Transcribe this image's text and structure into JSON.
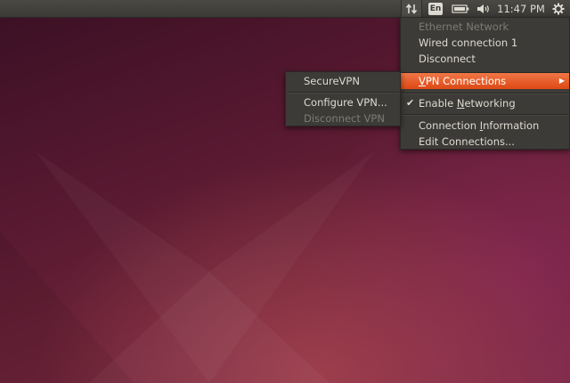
{
  "panel": {
    "keyboard_layout": "En",
    "clock": "11:47 PM",
    "icons": {
      "network": "network-updown-icon",
      "battery": "battery-icon",
      "sound": "speaker-volume-icon",
      "session": "gear-icon"
    }
  },
  "network_menu": {
    "section_header": "Ethernet Network",
    "wired_connection": "Wired connection 1",
    "disconnect": "Disconnect",
    "vpn_connections": {
      "mnemonic": "V",
      "rest": "PN Connections"
    },
    "enable_networking": {
      "before": "Enable ",
      "mnemonic": "N",
      "after": "etworking",
      "checked": true
    },
    "connection_information": {
      "before": "Connection ",
      "mnemonic": "I",
      "after": "nformation"
    },
    "edit_connections": "Edit Connections..."
  },
  "vpn_submenu": {
    "items": [
      {
        "label": "SecureVPN",
        "enabled": true
      },
      {
        "label": "Configure VPN...",
        "enabled": true
      },
      {
        "label": "Disconnect VPN",
        "enabled": false
      }
    ]
  },
  "colors": {
    "accent": "#dd4814",
    "menu_bg": "#3c3b37",
    "panel_bg": "#3b3a36",
    "menu_text": "#dfdbd2",
    "disabled_text": "#7e7b75"
  }
}
